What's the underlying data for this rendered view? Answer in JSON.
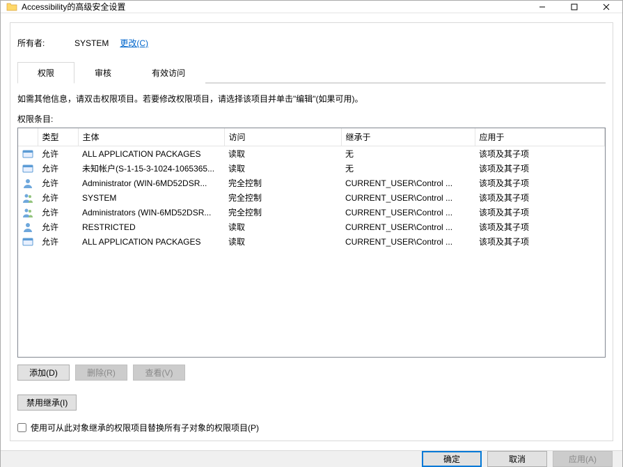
{
  "window": {
    "title": "Accessibility的高级安全设置"
  },
  "owner": {
    "label": "所有者:",
    "value": "SYSTEM",
    "change_link": "更改(C)"
  },
  "tabs": {
    "permissions": "权限",
    "auditing": "审核",
    "effective": "有效访问"
  },
  "hint": "如需其他信息，请双击权限项目。若要修改权限项目，请选择该项目并单击\"编辑\"(如果可用)。",
  "section_label": "权限条目:",
  "columns": {
    "type": "类型",
    "principal": "主体",
    "access": "访问",
    "inherited_from": "继承于",
    "applies_to": "应用于"
  },
  "rows": [
    {
      "icon": "group",
      "type": "允许",
      "principal": "ALL APPLICATION PACKAGES",
      "access": "读取",
      "inherited": "无",
      "applies": "该项及其子项"
    },
    {
      "icon": "group",
      "type": "允许",
      "principal": "未知帐户(S-1-15-3-1024-1065365...",
      "access": "读取",
      "inherited": "无",
      "applies": "该项及其子项"
    },
    {
      "icon": "user",
      "type": "允许",
      "principal": "Administrator (WIN-6MD52DSR...",
      "access": "完全控制",
      "inherited": "CURRENT_USER\\Control ...",
      "applies": "该项及其子项"
    },
    {
      "icon": "users",
      "type": "允许",
      "principal": "SYSTEM",
      "access": "完全控制",
      "inherited": "CURRENT_USER\\Control ...",
      "applies": "该项及其子项"
    },
    {
      "icon": "users",
      "type": "允许",
      "principal": "Administrators (WIN-6MD52DSR...",
      "access": "完全控制",
      "inherited": "CURRENT_USER\\Control ...",
      "applies": "该项及其子项"
    },
    {
      "icon": "user",
      "type": "允许",
      "principal": "RESTRICTED",
      "access": "读取",
      "inherited": "CURRENT_USER\\Control ...",
      "applies": "该项及其子项"
    },
    {
      "icon": "group",
      "type": "允许",
      "principal": "ALL APPLICATION PACKAGES",
      "access": "读取",
      "inherited": "CURRENT_USER\\Control ...",
      "applies": "该项及其子项"
    }
  ],
  "buttons": {
    "add": "添加(D)",
    "remove": "删除(R)",
    "view": "查看(V)",
    "disable_inherit": "禁用继承(I)"
  },
  "checkbox_label": "使用可从此对象继承的权限项目替换所有子对象的权限项目(P)",
  "footer": {
    "ok": "确定",
    "cancel": "取消",
    "apply": "应用(A)"
  }
}
